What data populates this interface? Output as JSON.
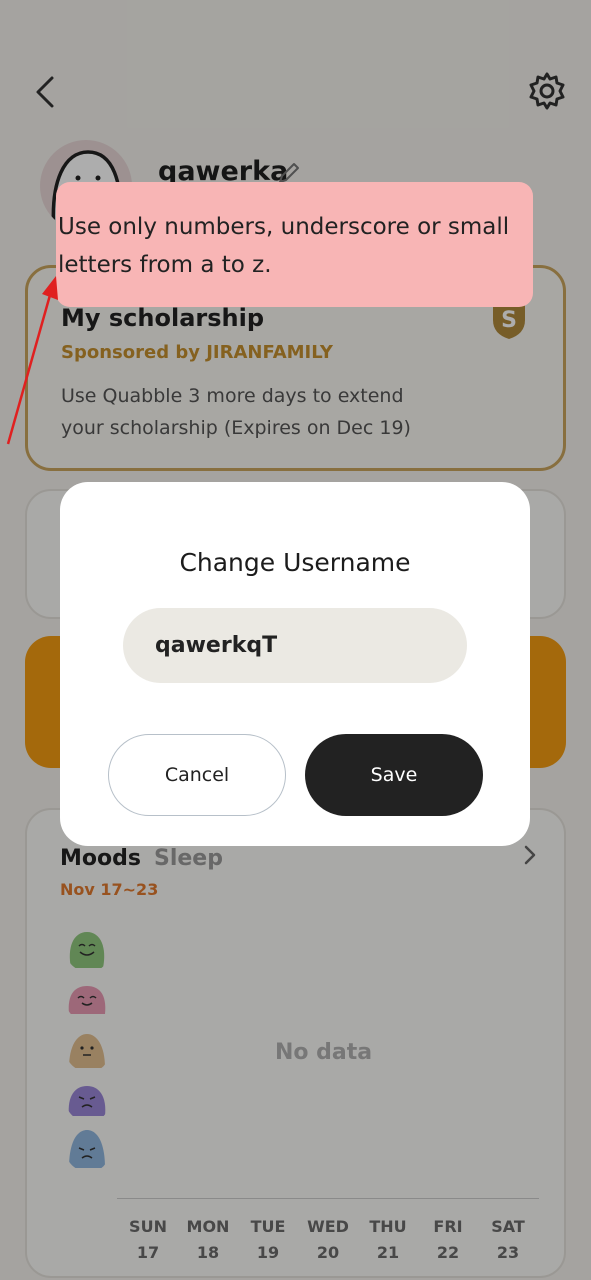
{
  "profile": {
    "username": "qawerka"
  },
  "scholarship": {
    "title": "My scholarship",
    "sponsor": "Sponsored by JIRANFAMILY",
    "description": "Use Quabble 3 more days to extend your scholarship (Expires on Dec 19)",
    "badge_letter": "S"
  },
  "moods_card": {
    "tabs": [
      "Moods",
      "Sleep"
    ],
    "date_range": "Nov 17~23",
    "empty_text": "No data",
    "days": [
      {
        "name": "SUN",
        "date": "17"
      },
      {
        "name": "MON",
        "date": "18"
      },
      {
        "name": "TUE",
        "date": "19"
      },
      {
        "name": "WED",
        "date": "20"
      },
      {
        "name": "THU",
        "date": "21"
      },
      {
        "name": "FRI",
        "date": "22"
      },
      {
        "name": "SAT",
        "date": "23"
      }
    ],
    "mood_icons": [
      "very-happy-face-icon",
      "happy-face-icon",
      "neutral-face-icon",
      "sad-face-icon",
      "very-sad-face-icon"
    ]
  },
  "dialog": {
    "title": "Change Username",
    "input_value": "qawerkqT",
    "cancel_label": "Cancel",
    "save_label": "Save"
  },
  "tooltip": {
    "text": "Use only numbers, underscore or small letters from a to z."
  },
  "colors": {
    "accent_gold": "#c9a45d",
    "accent_orange": "#f29b12",
    "tooltip_bg": "#f8b5b5",
    "arrow": "#e02020",
    "save_button": "#222222"
  }
}
